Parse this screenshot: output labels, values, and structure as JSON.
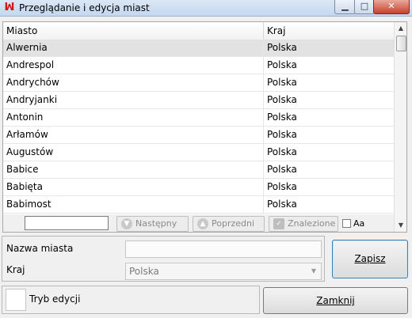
{
  "window": {
    "title": "Przeglądanie i edycja miast",
    "app_icon": "vs-logo-icon",
    "controls": [
      "minimize",
      "maximize",
      "close"
    ]
  },
  "grid": {
    "columns": [
      "Miasto",
      "Kraj"
    ],
    "rows": [
      {
        "city": "Alwernia",
        "country": "Polska"
      },
      {
        "city": "Andrespol",
        "country": "Polska"
      },
      {
        "city": "Andrychów",
        "country": "Polska"
      },
      {
        "city": "Andryjanki",
        "country": "Polska"
      },
      {
        "city": "Antonin",
        "country": "Polska"
      },
      {
        "city": "Arłamów",
        "country": "Polska"
      },
      {
        "city": "Augustów",
        "country": "Polska"
      },
      {
        "city": "Babice",
        "country": "Polska"
      },
      {
        "city": "Babięta",
        "country": "Polska"
      },
      {
        "city": "Babimost",
        "country": "Polska"
      }
    ],
    "selected_row": 0
  },
  "search": {
    "value": "",
    "next_label": "Następny",
    "prev_label": "Poprzedni",
    "found_label": "Znalezione",
    "case_label": "Aa"
  },
  "edit": {
    "name_label": "Nazwa miasta",
    "name_value": "",
    "country_label": "Kraj",
    "country_value": "Polska"
  },
  "buttons": {
    "save_label": "Zapisz",
    "close_label": "Zamknij"
  },
  "mode": {
    "label": "Tryb edycji"
  }
}
